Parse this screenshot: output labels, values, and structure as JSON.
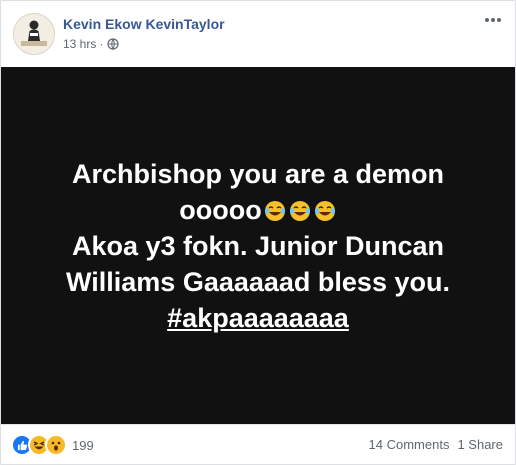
{
  "post": {
    "author": "Kevin Ekow KevinTaylor",
    "time": "13 hrs",
    "separator": "·",
    "privacy_icon": "globe-icon",
    "more_icon": "more-options-icon",
    "background_color": "#111111",
    "text_lines": [
      "Archbishop you are a demon",
      "ooooo",
      "Akoa y3 fokn. Junior Duncan",
      "Williams Gaaaaaad bless you."
    ],
    "emoji": "face-with-tears-of-joy-icon",
    "emoji_count": 3,
    "hashtag": "#akpaaaaaaaa"
  },
  "footer": {
    "reaction_icons": [
      "like-icon",
      "haha-icon",
      "wow-icon"
    ],
    "reaction_count": "199",
    "comments": "14 Comments",
    "shares": "1 Share"
  },
  "colors": {
    "author": "#385898",
    "meta": "#616770",
    "like": "#1877f2",
    "haha": "#f7b928"
  }
}
